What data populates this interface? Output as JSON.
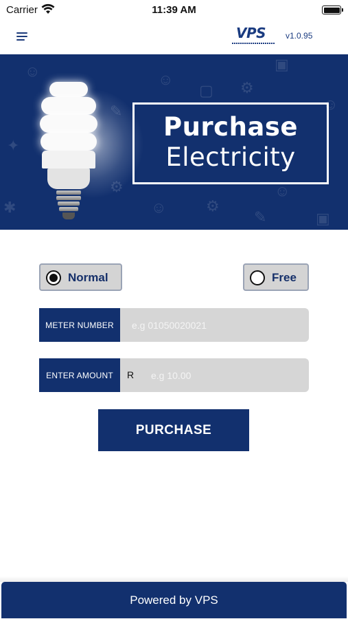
{
  "status_bar": {
    "carrier": "Carrier",
    "time": "11:39 AM"
  },
  "header": {
    "logo_text": "VPS",
    "version": "v1.0.95"
  },
  "banner": {
    "title_line1": "Purchase",
    "title_line2": "Electricity"
  },
  "options": {
    "normal_label": "Normal",
    "free_label": "Free",
    "selected": "Normal"
  },
  "form": {
    "meter_label": "METER NUMBER",
    "meter_placeholder": "e.g 01050020021",
    "meter_value": "",
    "amount_label": "ENTER AMOUNT",
    "amount_prefix": "R",
    "amount_placeholder": "e.g 10.00",
    "amount_value": ""
  },
  "purchase_label": "PURCHASE",
  "footer": {
    "text": "Powered by VPS"
  },
  "colors": {
    "primary": "#12306e",
    "field_bg": "#d6d6d6",
    "toggle_bg": "#d4d4d4"
  },
  "icons": [
    "wifi-icon",
    "battery-icon",
    "menu-icon",
    "lightbulb-icon"
  ]
}
